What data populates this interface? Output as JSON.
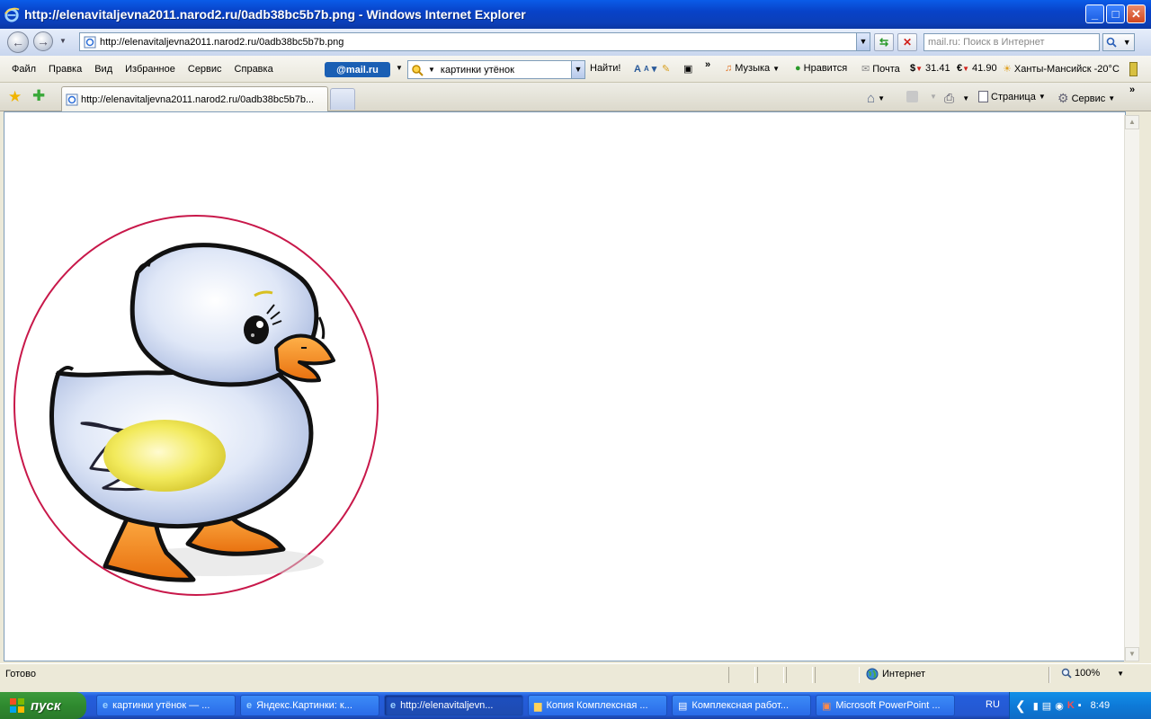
{
  "window": {
    "title": "http://elenavitaljevna2011.narod2.ru/0adb38bc5b7b.png - Windows Internet Explorer",
    "buttons": {
      "minimize": "_",
      "maximize": "□",
      "close": "✕"
    }
  },
  "address_bar": {
    "url": "http://elenavitaljevna2011.narod2.ru/0adb38bc5b7b.png",
    "search_placeholder": "mail.ru: Поиск в Интернет"
  },
  "menu": [
    "Файл",
    "Правка",
    "Вид",
    "Избранное",
    "Сервис",
    "Справка"
  ],
  "toolbar": {
    "logo": "@mail.ru",
    "search_value": "картинки утёнок",
    "find_button": "Найти!",
    "music": "Музыка",
    "like": "Нравится",
    "mail": "Почта",
    "usd": "31.41",
    "eur": "41.90",
    "weather": "Ханты-Мансийск -20°C"
  },
  "tabs": {
    "active_title": "http://elenavitaljevna2011.narod2.ru/0adb38bc5b7b...",
    "page_menu": "Страница",
    "tools_menu": "Сервис"
  },
  "status": {
    "text": "Готово",
    "zone": "Интернет",
    "zoom": "100%"
  },
  "taskbar": {
    "start": "пуск",
    "tasks": [
      "картинки утёнок — ...",
      "Яндекс.Картинки: к...",
      "http://elenavitaljevn...",
      "Копия Комплексная ...",
      "Комплексная работ...",
      "Microsoft PowerPoint ..."
    ],
    "language": "RU",
    "clock": "8:49"
  },
  "colors": {
    "titlebar": "#0842c8",
    "circle_border": "#c8184a",
    "duck_beak": "#f08a1c",
    "duck_wing": "#f0e866"
  }
}
